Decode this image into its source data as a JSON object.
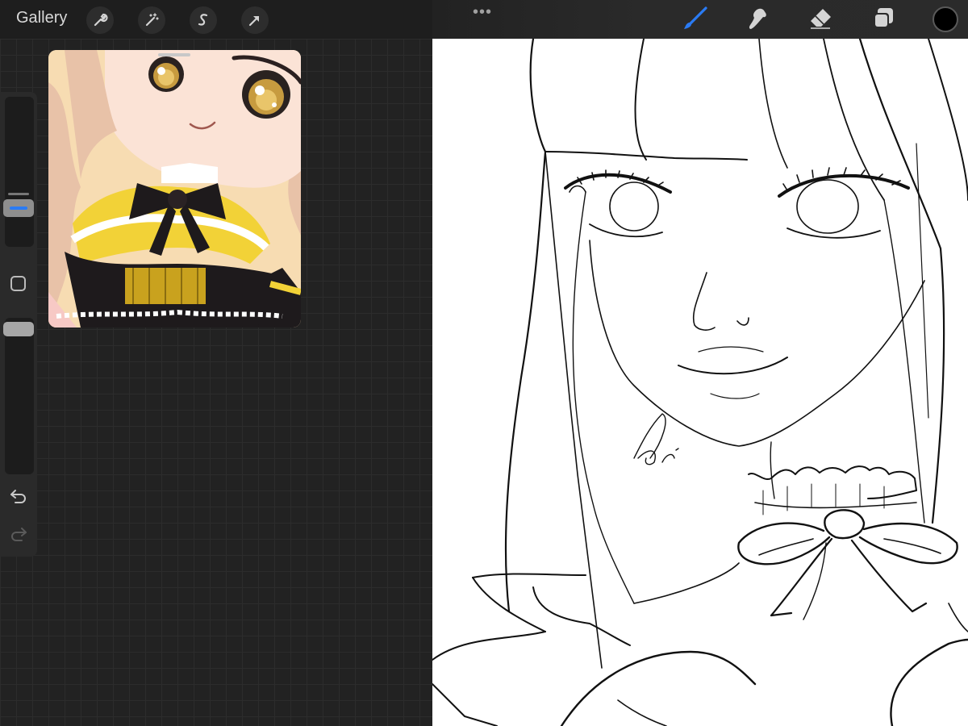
{
  "toolbar": {
    "gallery_label": "Gallery",
    "left_tools": [
      "wrench-icon",
      "magic-wand-icon",
      "selection-s-icon",
      "transform-arrow-icon"
    ],
    "more_label": "•••",
    "right_tools": [
      "brush-icon",
      "smudge-icon",
      "eraser-icon",
      "layers-icon"
    ],
    "active_tool": "brush-icon",
    "accent_color": "#2a7bf4",
    "current_color": "#000000"
  },
  "sidebar": {
    "tools": [
      "brush-size-slider",
      "modify-square-button",
      "opacity-slider",
      "undo-arrow-icon",
      "redo-arrow-icon"
    ]
  },
  "reference": {
    "colors": {
      "skin": "#fbe3d6",
      "hair": "#e8c2a8",
      "outfit_black": "#1e1a1c",
      "outfit_yellow": "#f2d237",
      "background": "#f7dcb2"
    }
  },
  "canvas": {
    "background": "#ffffff",
    "line_color": "#111111"
  }
}
